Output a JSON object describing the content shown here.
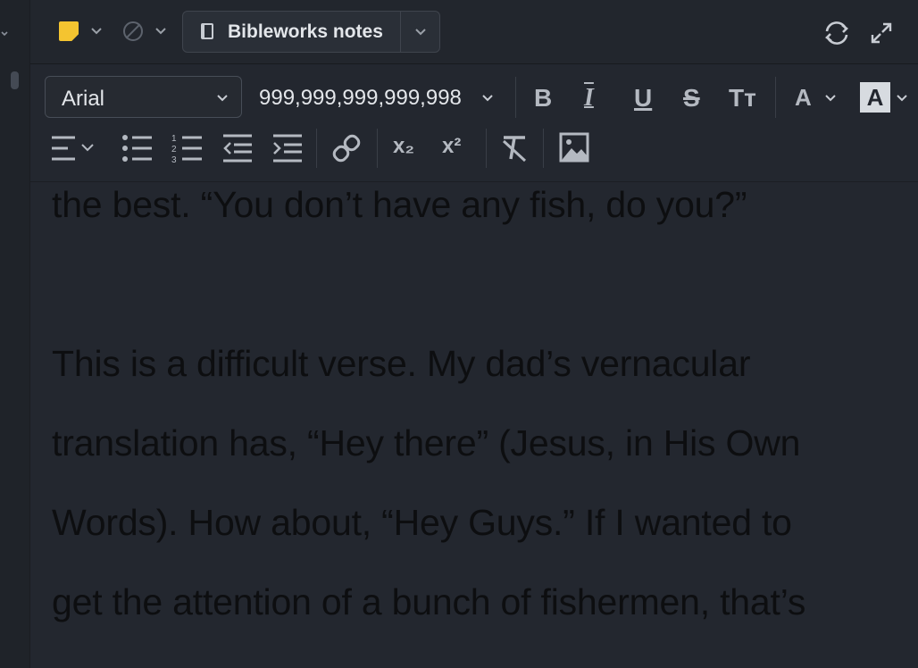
{
  "titlebar": {
    "note_title": "Bibleworks notes",
    "note_color": "#f4c430",
    "icons": [
      "note-color-icon",
      "chevron-down-icon",
      "no-entry-icon",
      "notebook-icon",
      "sync-icon",
      "expand-icon"
    ]
  },
  "toolbar": {
    "font_family": "Arial",
    "font_size": "999,999,999,999,998",
    "buttons": {
      "bold": "B",
      "italic": "I",
      "underline": "U",
      "strikethrough": "S",
      "text_size": "Tт",
      "font_color": "A",
      "highlight": "A",
      "subscript": "x₂",
      "superscript": "x²"
    }
  },
  "editor": {
    "lines": [
      "the best. “You don’t have any fish, do you?”",
      "This is a difficult verse. My dad’s vernacular",
      "translation has, “Hey there” (Jesus, in His Own",
      "Words). How about, “Hey Guys.” If I wanted to",
      "get the attention of a bunch of fishermen, that’s"
    ]
  },
  "colors": {
    "background": "#23272f",
    "text": "#0d0e10",
    "accent": "#f4c430"
  }
}
